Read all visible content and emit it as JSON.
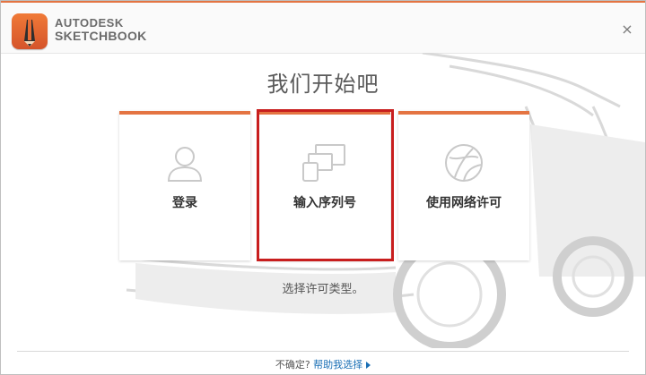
{
  "app": {
    "logo_line1": "AUTODESK",
    "logo_line2": "SKETCHBOOK",
    "close_glyph": "×"
  },
  "main": {
    "title": "我们开始吧",
    "subtitle": "选择许可类型。",
    "cards": [
      {
        "label": "登录",
        "icon": "user-icon"
      },
      {
        "label": "输入序列号",
        "icon": "devices-icon"
      },
      {
        "label": "使用网络许可",
        "icon": "network-globe-icon"
      }
    ],
    "highlighted_card": 1
  },
  "footer": {
    "prompt": "不确定?",
    "help_link": "帮助我选择"
  },
  "colors": {
    "accent": "#e47442",
    "highlight": "#c81e1e",
    "link": "#1a6fb5"
  }
}
